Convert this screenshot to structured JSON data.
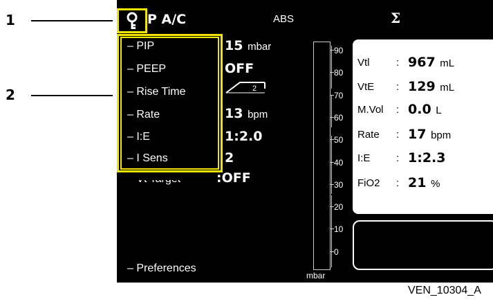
{
  "callouts": [
    {
      "number": "1"
    },
    {
      "number": "2"
    }
  ],
  "header": {
    "mode": "P A/C",
    "abs_label": "ABS",
    "lock_icon": "key-lock-icon",
    "sigma_icon": "sigma-icon",
    "sigma_glyph": "Σ"
  },
  "settings": [
    {
      "label": "– PIP",
      "value": "15",
      "unit": "mbar"
    },
    {
      "label": "– PEEP",
      "value": "OFF",
      "unit": ""
    },
    {
      "label": "– Rise Time",
      "value": "2",
      "unit": "",
      "icon": "rise-time-ramp-icon"
    },
    {
      "label": "– Rate",
      "value": "13",
      "unit": "bpm"
    },
    {
      "label": "– I:E",
      "value": "1:2.0",
      "unit": ""
    },
    {
      "label": "– I Sens",
      "value": "2",
      "unit": ""
    },
    {
      "label": "– Vt Target",
      "value": ":OFF",
      "unit": ""
    }
  ],
  "preferences_label": "– Preferences",
  "gauge": {
    "ticks": [
      "90",
      "80",
      "70",
      "60",
      "50",
      "40",
      "30",
      "20",
      "10",
      "0"
    ],
    "unit": "mbar",
    "range": [
      0,
      90
    ]
  },
  "monitor": [
    {
      "label": "Vtl",
      "colon": ":",
      "value": "967",
      "unit": "mL"
    },
    {
      "label": "VtE",
      "colon": ":",
      "value": "129",
      "unit": "mL"
    },
    {
      "label": "M.Vol",
      "colon": ":",
      "value": "0.0",
      "unit": "L"
    },
    {
      "label": "Rate",
      "colon": ":",
      "value": "17",
      "unit": "bpm"
    },
    {
      "label": "I:E",
      "colon": ":",
      "value": "1:2.3",
      "unit": ""
    },
    {
      "label": "FiO2",
      "colon": ":",
      "value": "21",
      "unit": "%"
    }
  ],
  "caption": "VEN_10304_A",
  "colors": {
    "highlight": "#f2e600",
    "screen": "#000000",
    "text": "#ffffff"
  }
}
